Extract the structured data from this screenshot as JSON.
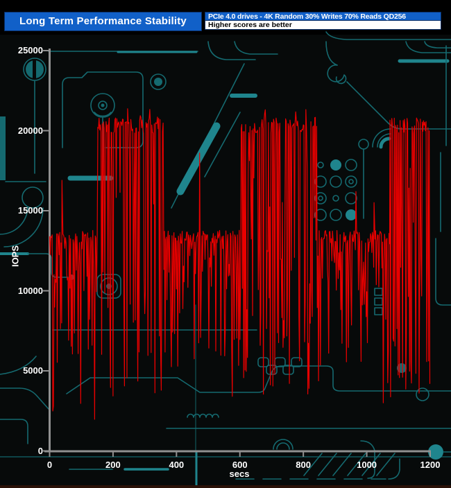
{
  "header": {
    "title": "Long Term Performance Stability",
    "subtitle": "PCIe 4.0 drives - 4K Random 30% Writes 70% Reads QD256",
    "note": "Higher scores are better",
    "title_bg_color": "#1160c8",
    "note_bg_color": "#ffffff"
  },
  "axes": {
    "y_label": "IOPS",
    "x_label": "secs",
    "axis_color": "#909090",
    "tick_text_color": "#ffffff"
  },
  "background": {
    "board_color": "#070a0a",
    "trace_color": "#156a70",
    "trace_bright_color": "#1f858d",
    "bottom_strip_color": "#2a1107"
  },
  "chart_data": {
    "type": "line",
    "title": "Long Term Performance Stability",
    "subtitle": "PCIe 4.0 drives - 4K Random 30% Writes 70% Reads QD256",
    "note": "Higher scores are better",
    "xlabel": "secs",
    "ylabel": "IOPS",
    "xlim": [
      0,
      1200
    ],
    "ylim": [
      0,
      25000
    ],
    "x_ticks": [
      0,
      200,
      400,
      600,
      800,
      1000,
      1200
    ],
    "y_ticks": [
      0,
      5000,
      10000,
      15000,
      20000,
      25000
    ],
    "grid": false,
    "legend": "none",
    "line_color": "#e80000",
    "series_name": "4K Random 30% Writes 70% Reads QD256 IOPS",
    "sample_step_sec": 2,
    "seed": 11,
    "phases": [
      {
        "mode": "steady",
        "start_sec": 0,
        "end_sec": 152,
        "base_iops": 13350,
        "jitter": 420,
        "dip_shallow": [
          9800,
          12700
        ],
        "dip_mid": [
          6400,
          9600
        ],
        "dip_deep": [
          5000,
          6800
        ],
        "dip_extreme": [
          1900,
          3400
        ]
      },
      {
        "mode": "burst",
        "start_sec": 152,
        "end_sec": 360,
        "top_iops": 20300,
        "jitter": 500,
        "mid_range": [
          13000,
          18200
        ],
        "low_range": [
          5000,
          12600
        ],
        "low_deep": [
          3300,
          5000
        ],
        "peak_iops": 21400
      },
      {
        "mode": "steady",
        "start_sec": 360,
        "end_sec": 600,
        "base_iops": 13350,
        "jitter": 420,
        "dip_shallow": [
          9800,
          12700
        ],
        "dip_mid": [
          6400,
          9600
        ],
        "dip_deep": [
          5000,
          6800
        ],
        "dip_extreme": [
          2700,
          4300
        ]
      },
      {
        "mode": "burst",
        "start_sec": 600,
        "end_sec": 850,
        "top_iops": 20300,
        "jitter": 500,
        "mid_range": [
          13000,
          18200
        ],
        "low_range": [
          5000,
          12600
        ],
        "low_deep": [
          3300,
          5000
        ],
        "peak_iops": 21400
      },
      {
        "mode": "steady",
        "start_sec": 850,
        "end_sec": 1073,
        "base_iops": 13350,
        "jitter": 420,
        "dip_shallow": [
          9800,
          12700
        ],
        "dip_mid": [
          6400,
          9600
        ],
        "dip_deep": [
          5000,
          6800
        ],
        "dip_extreme": [
          3000,
          4500
        ]
      },
      {
        "mode": "burst",
        "start_sec": 1073,
        "end_sec": 1200,
        "top_iops": 20300,
        "jitter": 500,
        "mid_range": [
          13000,
          18200
        ],
        "low_range": [
          5000,
          12600
        ],
        "low_deep": [
          3300,
          5000
        ],
        "peak_iops": 21400
      }
    ],
    "upspikes": [
      {
        "sec": 39,
        "iops": 16900
      },
      {
        "sec": 473,
        "iops": 18600
      },
      {
        "sec": 966,
        "iops": 16200
      },
      {
        "sec": 1023,
        "iops": 15500
      }
    ],
    "summary": {
      "steady_level_iops": 13350,
      "burst_top_level_iops": 20300,
      "peak_iops": 21400,
      "burst_windows_sec": [
        [
          152,
          360
        ],
        [
          600,
          850
        ],
        [
          1073,
          1200
        ]
      ],
      "steady_windows_sec": [
        [
          0,
          152
        ],
        [
          360,
          600
        ],
        [
          850,
          1073
        ]
      ]
    }
  }
}
